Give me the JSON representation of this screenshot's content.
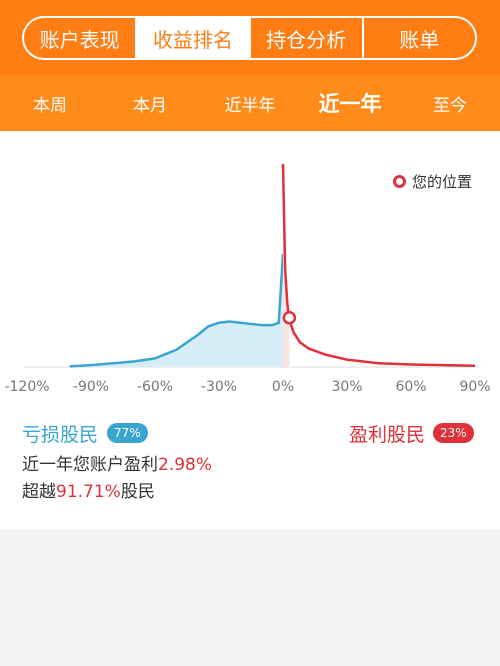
{
  "tabs": [
    {
      "label": "账户表现"
    },
    {
      "label": "收益排名"
    },
    {
      "label": "持仓分析"
    },
    {
      "label": "账单"
    }
  ],
  "active_tab": "收益排名",
  "periods": [
    {
      "label": "本周"
    },
    {
      "label": "本月"
    },
    {
      "label": "近半年"
    },
    {
      "label": "近一年"
    },
    {
      "label": "至今"
    }
  ],
  "active_period": "近一年",
  "legend": {
    "label": "您的位置"
  },
  "loss": {
    "label": "亏损股民",
    "percent": "77%"
  },
  "gain": {
    "label": "盈利股民",
    "percent": "23%"
  },
  "summary": {
    "line1_prefix": "近一年您账户盈利",
    "line1_value": "2.98%",
    "line2_prefix": "超越",
    "line2_value": "91.71%",
    "line2_suffix": "股民"
  },
  "colors": {
    "accent": "#ff7d12",
    "loss": "#3aa6cf",
    "gain": "#e0303a"
  },
  "chart_data": {
    "type": "area",
    "x_ticks": [
      "-120%",
      "-90%",
      "-60%",
      "-30%",
      "0%",
      "30%",
      "60%",
      "90%"
    ],
    "xlim": [
      -120,
      90
    ],
    "marker": {
      "x": 2.98
    },
    "series": [
      {
        "x": [
          -100,
          -90,
          -80,
          -70,
          -60,
          -50,
          -40,
          -35,
          -30,
          -25,
          -20,
          -15,
          -10,
          -5,
          -2,
          0
        ],
        "y": [
          0.5,
          1.5,
          3,
          4.5,
          7,
          14,
          26,
          33,
          36,
          37,
          36,
          35,
          34,
          34,
          36,
          92
        ]
      },
      {
        "x": [
          0,
          0.3,
          1,
          2,
          3,
          5,
          8,
          12,
          20,
          30,
          45,
          60,
          90
        ],
        "y": [
          165,
          140,
          80,
          52,
          38,
          28,
          20,
          15,
          10,
          6,
          3,
          2,
          1
        ]
      }
    ]
  }
}
